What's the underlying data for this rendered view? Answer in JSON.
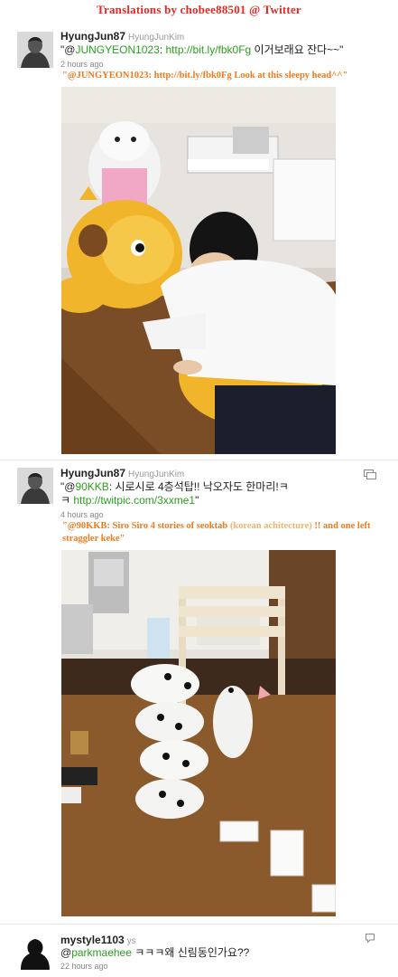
{
  "banner": "Translations by chobee88501 @ Twitter",
  "tweets": [
    {
      "username": "HyungJun87",
      "real_name": "HyungJunKim",
      "text_prefix": "\"@",
      "mention": "JUNGYEON1023",
      "text_mid": ": ",
      "link": "http://bit.ly/fbk0Fg",
      "text_suffix": " 이거보래요 잔다~~\"",
      "time": "2 hours ago",
      "translation": "\"@JUNGYEON1023: http://bit.ly/fbk0Fg Look at this sleepy head^^\""
    },
    {
      "username": "HyungJun87",
      "real_name": "HyungJunKim",
      "text_prefix": "\"@",
      "mention": "90KKB",
      "text_line1_rest": ": 시로시로 4층석탑!! 낙오자도 한마리!ㅋ",
      "line2_prefix": "ㅋ ",
      "link": "http://twitpic.com/3xxme1",
      "line2_suffix": "\"",
      "time": "4 hours ago",
      "translation_part1": "\"@90KKB: Siro Siro 4 stories of seoktab ",
      "translation_hl": "(korean achitecture)",
      "translation_part2": " !! and one left straggler keke\""
    },
    {
      "username": "mystyle1103",
      "real_name": "ys",
      "mention": "parkmaehee",
      "text_suffix": " ㅋㅋㅋ왜 신림동인가요??",
      "time": "22 hours ago"
    }
  ],
  "icons": {
    "retweet": "retweet-icon",
    "reply": "reply-icon"
  },
  "colors": {
    "banner": "#e8261e",
    "translation": "#f07a1e",
    "link": "#2a9e1f"
  }
}
